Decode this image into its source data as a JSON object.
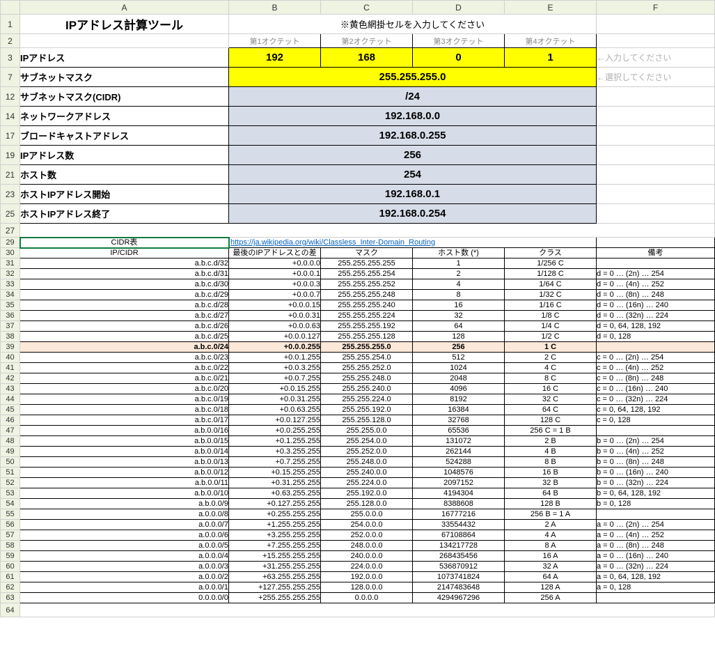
{
  "cols": [
    "A",
    "B",
    "C",
    "D",
    "E",
    "F"
  ],
  "title": "IPアドレス計算ツール",
  "instruction": "※黄色網掛セルを入力してください",
  "octet_labels": [
    "第1オクテット",
    "第2オクテット",
    "第3オクテット",
    "第4オクテット"
  ],
  "rows": {
    "ip": {
      "label": "IPアドレス",
      "values": [
        "192",
        "168",
        "0",
        "1"
      ],
      "hint": "←入力してください"
    },
    "mask": {
      "label": "サブネットマスク",
      "value": "255.255.255.0",
      "hint": "←選択してください"
    },
    "cidr": {
      "label": "サブネットマスク(CIDR)",
      "value": "/24"
    },
    "network": {
      "label": "ネットワークアドレス",
      "value": "192.168.0.0"
    },
    "broadcast": {
      "label": "ブロードキャストアドレス",
      "value": "192.168.0.255"
    },
    "ipcount": {
      "label": "IPアドレス数",
      "value": "256"
    },
    "hostcount": {
      "label": "ホスト数",
      "value": "254"
    },
    "hoststart": {
      "label": "ホストIPアドレス開始",
      "value": "192.168.0.1"
    },
    "hostend": {
      "label": "ホストIPアドレス終了",
      "value": "192.168.0.254"
    }
  },
  "row_nums": {
    "title": "1",
    "octets": "2",
    "ip": "3",
    "mask": "7",
    "cidr": "12",
    "network": "14",
    "broadcast": "17",
    "ipcount": "19",
    "hostcount": "21",
    "hoststart": "23",
    "hostend": "25",
    "blank": "27",
    "cidr_title": "29",
    "cidr_hdr": "30"
  },
  "cidr_section": {
    "title": "CIDR表",
    "link": "https://ja.wikipedia.org/wiki/Classless_Inter-Domain_Routing",
    "headers": [
      "IP/CIDR",
      "最後のIPアドレスとの差",
      "マスク",
      "ホスト数 (*)",
      "クラス",
      "備考"
    ],
    "rows": [
      {
        "n": "31",
        "d": [
          "a.b.c.d/32",
          "+0.0.0.0",
          "255.255.255.255",
          "1",
          "1/256 C",
          ""
        ],
        "hl": false
      },
      {
        "n": "32",
        "d": [
          "a.b.c.d/31",
          "+0.0.0.1",
          "255.255.255.254",
          "2",
          "1/128 C",
          "d = 0 … (2n) … 254"
        ],
        "hl": false
      },
      {
        "n": "33",
        "d": [
          "a.b.c.d/30",
          "+0.0.0.3",
          "255.255.255.252",
          "4",
          "1/64 C",
          "d = 0 … (4n) … 252"
        ],
        "hl": false
      },
      {
        "n": "34",
        "d": [
          "a.b.c.d/29",
          "+0.0.0.7",
          "255.255.255.248",
          "8",
          "1/32 C",
          "d = 0 … (8n) … 248"
        ],
        "hl": false
      },
      {
        "n": "35",
        "d": [
          "a.b.c.d/28",
          "+0.0.0.15",
          "255.255.255.240",
          "16",
          "1/16 C",
          "d = 0 … (16n) … 240"
        ],
        "hl": false
      },
      {
        "n": "36",
        "d": [
          "a.b.c.d/27",
          "+0.0.0.31",
          "255.255.255.224",
          "32",
          "1/8 C",
          "d = 0 … (32n) … 224"
        ],
        "hl": false
      },
      {
        "n": "37",
        "d": [
          "a.b.c.d/26",
          "+0.0.0.63",
          "255.255.255.192",
          "64",
          "1/4 C",
          "d = 0, 64, 128, 192"
        ],
        "hl": false
      },
      {
        "n": "38",
        "d": [
          "a.b.c.d/25",
          "+0.0.0.127",
          "255.255.255.128",
          "128",
          "1/2 C",
          "d = 0, 128"
        ],
        "hl": false
      },
      {
        "n": "39",
        "d": [
          "a.b.c.0/24",
          "+0.0.0.255",
          "255.255.255.0",
          "256",
          "1 C",
          ""
        ],
        "hl": true
      },
      {
        "n": "40",
        "d": [
          "a.b.c.0/23",
          "+0.0.1.255",
          "255.255.254.0",
          "512",
          "2 C",
          "c = 0 … (2n) … 254"
        ],
        "hl": false
      },
      {
        "n": "41",
        "d": [
          "a.b.c.0/22",
          "+0.0.3.255",
          "255.255.252.0",
          "1024",
          "4 C",
          "c = 0 … (4n) … 252"
        ],
        "hl": false
      },
      {
        "n": "42",
        "d": [
          "a.b.c.0/21",
          "+0.0.7.255",
          "255.255.248.0",
          "2048",
          "8 C",
          "c = 0 … (8n) … 248"
        ],
        "hl": false
      },
      {
        "n": "43",
        "d": [
          "a.b.c.0/20",
          "+0.0.15.255",
          "255.255.240.0",
          "4096",
          "16 C",
          "c = 0 … (16n) … 240"
        ],
        "hl": false
      },
      {
        "n": "44",
        "d": [
          "a.b.c.0/19",
          "+0.0.31.255",
          "255.255.224.0",
          "8192",
          "32 C",
          "c = 0 … (32n) … 224"
        ],
        "hl": false
      },
      {
        "n": "45",
        "d": [
          "a.b.c.0/18",
          "+0.0.63.255",
          "255.255.192.0",
          "16384",
          "64 C",
          "c = 0, 64, 128, 192"
        ],
        "hl": false
      },
      {
        "n": "46",
        "d": [
          "a.b.c.0/17",
          "+0.0.127.255",
          "255.255.128.0",
          "32768",
          "128 C",
          "c = 0, 128"
        ],
        "hl": false
      },
      {
        "n": "47",
        "d": [
          "a.b.0.0/16",
          "+0.0.255.255",
          "255.255.0.0",
          "65536",
          "256 C = 1 B",
          ""
        ],
        "hl": false
      },
      {
        "n": "48",
        "d": [
          "a.b.0.0/15",
          "+0.1.255.255",
          "255.254.0.0",
          "131072",
          "2 B",
          "b = 0 … (2n) … 254"
        ],
        "hl": false
      },
      {
        "n": "49",
        "d": [
          "a.b.0.0/14",
          "+0.3.255.255",
          "255.252.0.0",
          "262144",
          "4 B",
          "b = 0 … (4n) … 252"
        ],
        "hl": false
      },
      {
        "n": "50",
        "d": [
          "a.b.0.0/13",
          "+0.7.255.255",
          "255.248.0.0",
          "524288",
          "8 B",
          "b = 0 … (8n) … 248"
        ],
        "hl": false
      },
      {
        "n": "51",
        "d": [
          "a.b.0.0/12",
          "+0.15.255.255",
          "255.240.0.0",
          "1048576",
          "16 B",
          "b = 0 … (16n) … 240"
        ],
        "hl": false
      },
      {
        "n": "52",
        "d": [
          "a.b.0.0/11",
          "+0.31.255.255",
          "255.224.0.0",
          "2097152",
          "32 B",
          "b = 0 … (32n) … 224"
        ],
        "hl": false
      },
      {
        "n": "53",
        "d": [
          "a.b.0.0/10",
          "+0.63.255.255",
          "255.192.0.0",
          "4194304",
          "64 B",
          "b = 0, 64, 128, 192"
        ],
        "hl": false
      },
      {
        "n": "54",
        "d": [
          "a.b.0.0/9",
          "+0.127.255.255",
          "255.128.0.0",
          "8388608",
          "128 B",
          "b = 0, 128"
        ],
        "hl": false
      },
      {
        "n": "55",
        "d": [
          "a.0.0.0/8",
          "+0.255.255.255",
          "255.0.0.0",
          "16777216",
          "256 B = 1 A",
          ""
        ],
        "hl": false
      },
      {
        "n": "56",
        "d": [
          "a.0.0.0/7",
          "+1.255.255.255",
          "254.0.0.0",
          "33554432",
          "2 A",
          "a = 0 … (2n) … 254"
        ],
        "hl": false
      },
      {
        "n": "57",
        "d": [
          "a.0.0.0/6",
          "+3.255.255.255",
          "252.0.0.0",
          "67108864",
          "4 A",
          "a = 0 … (4n) … 252"
        ],
        "hl": false
      },
      {
        "n": "58",
        "d": [
          "a.0.0.0/5",
          "+7.255.255.255",
          "248.0.0.0",
          "134217728",
          "8 A",
          "a = 0 … (8n) … 248"
        ],
        "hl": false
      },
      {
        "n": "59",
        "d": [
          "a.0.0.0/4",
          "+15.255.255.255",
          "240.0.0.0",
          "268435456",
          "16 A",
          "a = 0 … (16n) … 240"
        ],
        "hl": false
      },
      {
        "n": "60",
        "d": [
          "a.0.0.0/3",
          "+31.255.255.255",
          "224.0.0.0",
          "536870912",
          "32 A",
          "a = 0 … (32n) … 224"
        ],
        "hl": false
      },
      {
        "n": "61",
        "d": [
          "a.0.0.0/2",
          "+63.255.255.255",
          "192.0.0.0",
          "1073741824",
          "64 A",
          "a = 0, 64, 128, 192"
        ],
        "hl": false
      },
      {
        "n": "62",
        "d": [
          "a.0.0.0/1",
          "+127.255.255.255",
          "128.0.0.0",
          "2147483648",
          "128 A",
          "a = 0, 128"
        ],
        "hl": false
      },
      {
        "n": "63",
        "d": [
          "0.0.0.0/0",
          "+255.255.255.255",
          "0.0.0.0",
          "4294967296",
          "256 A",
          ""
        ],
        "hl": false
      }
    ]
  },
  "last_row": "64"
}
